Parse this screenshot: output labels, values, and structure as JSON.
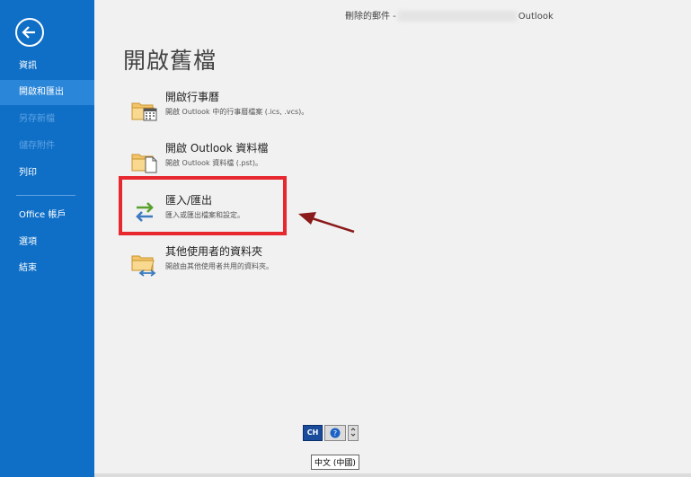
{
  "window": {
    "title_prefix": "刪除的郵件 -",
    "title_suffix": "Outlook"
  },
  "sidebar": {
    "items": [
      {
        "label": "資訊"
      },
      {
        "label": "開啟和匯出"
      },
      {
        "label": "另存新檔"
      },
      {
        "label": "儲存附件"
      },
      {
        "label": "列印"
      },
      {
        "label": "Office 帳戶"
      },
      {
        "label": "選項"
      },
      {
        "label": "結束"
      }
    ]
  },
  "main": {
    "title": "開啟舊檔",
    "options": [
      {
        "title": "開啟行事曆",
        "desc": "開啟 Outlook 中的行事曆檔案 (.ics, .vcs)。"
      },
      {
        "title": "開啟 Outlook 資料檔",
        "desc": "開啟 Outlook 資料檔 (.pst)。"
      },
      {
        "title": "匯入/匯出",
        "desc": "匯入或匯出檔案和設定。"
      },
      {
        "title": "其他使用者的資料夾",
        "desc": "開啟由其他使用者共用的資料夾。"
      }
    ]
  },
  "ime": {
    "mode": "CH",
    "help": "?",
    "tooltip": "中文 (中國)"
  },
  "colors": {
    "sidebar": "#0f6fc6",
    "highlight": "#e8282f",
    "arrow": "#8b1a1a"
  }
}
